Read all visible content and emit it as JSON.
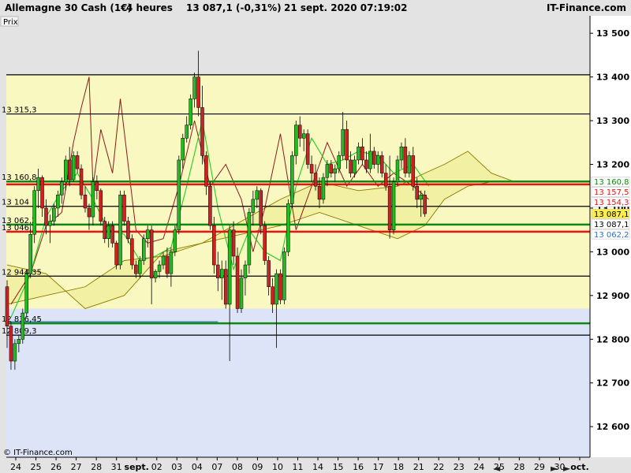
{
  "header": {
    "instrument": "Allemagne 30 Cash (1€)",
    "timeframe": "4 heures",
    "quote": "13 087,1 (-0,31%)",
    "datetime": "21 sept. 2020 07:19:02",
    "site": "IT-Finance.com"
  },
  "panel_label": "Prix",
  "copyright": "© IT-Finance.com",
  "nav_arrows": [
    "◄",
    "►",
    "►"
  ],
  "colors": {
    "bull": "#22bb22",
    "bear": "#cc2222",
    "resistance": "#ee1111",
    "support": "#118811",
    "zone_upper": "#f8f8c0",
    "zone_lower": "#dde4f8",
    "cloud": "#f0ed9a",
    "kijun": "#8b1a1a",
    "tenkan": "#22cc22",
    "chikou": "#3070cc",
    "senkou": "#8a7a00"
  },
  "chart_data": {
    "type": "candlestick",
    "yaxis": {
      "ticks": [
        "13 500",
        "13 400",
        "13 300",
        "13 200",
        "13 100",
        "13 000",
        "12 900",
        "12 800",
        "12 700",
        "12 600"
      ],
      "tick_values": [
        13500,
        13400,
        13300,
        13200,
        13100,
        13000,
        12900,
        12800,
        12700,
        12600
      ],
      "ylim": [
        12530,
        13540
      ]
    },
    "xaxis": {
      "ticks": [
        "24",
        "25",
        "26",
        "27",
        "28",
        "31",
        "sept.",
        "02",
        "03",
        "04",
        "07",
        "08",
        "09",
        "10",
        "11",
        "14",
        "15",
        "16",
        "17",
        "18",
        "21",
        "22",
        "23",
        "24",
        "25",
        "28",
        "29",
        "30",
        "oct."
      ]
    },
    "zones": [
      {
        "from": 12870,
        "to": 13405,
        "color": "upper"
      },
      {
        "from": 12530,
        "to": 12870,
        "color": "lower"
      }
    ],
    "levels": [
      {
        "value": 13405,
        "label": "",
        "kind": "black"
      },
      {
        "value": 13315.3,
        "label": "13 315,3",
        "kind": "black"
      },
      {
        "value": 13160.8,
        "label": "13 160,8",
        "kind": "support"
      },
      {
        "value": 13154.3,
        "label": "",
        "kind": "resistance"
      },
      {
        "value": 13104,
        "label": "13 104",
        "kind": "black"
      },
      {
        "value": 13062.2,
        "label": "13 062,2",
        "kind": "support"
      },
      {
        "value": 13046.1,
        "label": "13 046,1",
        "kind": "resistance"
      },
      {
        "value": 12944.35,
        "label": "12 944,35",
        "kind": "black"
      },
      {
        "value": 12836.45,
        "label": "12 836,45",
        "kind": "support"
      },
      {
        "value": 12809.3,
        "label": "12 809,3",
        "kind": "black"
      }
    ],
    "price_badges": [
      {
        "value": 13160.8,
        "label": "13 160,8",
        "color": "#118811",
        "bg": "#ffffff"
      },
      {
        "value": 13157.5,
        "label": "13 157,5",
        "color": "#ee1111",
        "bg": "#ffffff"
      },
      {
        "value": 13154.3,
        "label": "13 154,3",
        "color": "#ee1111",
        "bg": "#ffffff"
      },
      {
        "value": 13087.1,
        "label": "13 087,1",
        "color": "#000000",
        "bg": "#ffee44"
      },
      {
        "value": 13087.1,
        "label": "13 087,1",
        "color": "#000000",
        "bg": "#ffffff"
      },
      {
        "value": 13062.2,
        "label": "13 062,2",
        "color": "#3070cc",
        "bg": "#ffffff"
      }
    ],
    "candles": [
      [
        12920,
        12935,
        12780,
        12830
      ],
      [
        12830,
        12840,
        12730,
        12750
      ],
      [
        12750,
        12800,
        12730,
        12790
      ],
      [
        12790,
        12810,
        12770,
        12800
      ],
      [
        12800,
        12870,
        12790,
        12860
      ],
      [
        12860,
        12960,
        12850,
        12950
      ],
      [
        12950,
        13060,
        12940,
        13040
      ],
      [
        13040,
        13150,
        13020,
        13140
      ],
      [
        13140,
        13190,
        13100,
        13170
      ],
      [
        13170,
        13175,
        13080,
        13100
      ],
      [
        13100,
        13120,
        13040,
        13060
      ],
      [
        13060,
        13085,
        13020,
        13070
      ],
      [
        13070,
        13110,
        13060,
        13100
      ],
      [
        13100,
        13140,
        13080,
        13130
      ],
      [
        13130,
        13170,
        13110,
        13160
      ],
      [
        13160,
        13220,
        13140,
        13210
      ],
      [
        13210,
        13240,
        13150,
        13165
      ],
      [
        13165,
        13230,
        13160,
        13220
      ],
      [
        13220,
        13230,
        13180,
        13190
      ],
      [
        13190,
        13200,
        13120,
        13130
      ],
      [
        13130,
        13150,
        13090,
        13100
      ],
      [
        13100,
        13110,
        13050,
        13080
      ],
      [
        13080,
        13170,
        13060,
        13160
      ],
      [
        13160,
        13175,
        13120,
        13140
      ],
      [
        13140,
        13145,
        13060,
        13070
      ],
      [
        13070,
        13080,
        13020,
        13030
      ],
      [
        13030,
        13070,
        13010,
        13060
      ],
      [
        13060,
        13070,
        13010,
        13020
      ],
      [
        13020,
        13025,
        12960,
        12970
      ],
      [
        12970,
        13140,
        12960,
        13130
      ],
      [
        13130,
        13140,
        13060,
        13070
      ],
      [
        13070,
        13080,
        13020,
        13030
      ],
      [
        13030,
        13040,
        12960,
        12970
      ],
      [
        12970,
        12980,
        12940,
        12950
      ],
      [
        12950,
        12990,
        12940,
        12980
      ],
      [
        12980,
        13040,
        12970,
        13030
      ],
      [
        13030,
        13060,
        13010,
        13050
      ],
      [
        13050,
        13060,
        12880,
        12940
      ],
      [
        12940,
        12960,
        12930,
        12955
      ],
      [
        12955,
        12980,
        12940,
        12970
      ],
      [
        12970,
        13000,
        12960,
        12990
      ],
      [
        12990,
        13010,
        12940,
        12950
      ],
      [
        12950,
        13010,
        12920,
        13000
      ],
      [
        13000,
        13060,
        12990,
        13050
      ],
      [
        13050,
        13220,
        13040,
        13210
      ],
      [
        13210,
        13270,
        13190,
        13260
      ],
      [
        13260,
        13310,
        13250,
        13290
      ],
      [
        13290,
        13360,
        13280,
        13350
      ],
      [
        13350,
        13410,
        13330,
        13400
      ],
      [
        13400,
        13460,
        13310,
        13330
      ],
      [
        13330,
        13380,
        13200,
        13220
      ],
      [
        13220,
        13230,
        13130,
        13150
      ],
      [
        13150,
        13160,
        13050,
        13060
      ],
      [
        13060,
        13080,
        12950,
        12970
      ],
      [
        12970,
        13000,
        12910,
        12940
      ],
      [
        12940,
        12980,
        12890,
        12960
      ],
      [
        12960,
        12980,
        12870,
        12880
      ],
      [
        12880,
        13060,
        12750,
        13050
      ],
      [
        13050,
        13070,
        12970,
        12990
      ],
      [
        12990,
        13010,
        12860,
        12870
      ],
      [
        12870,
        12960,
        12860,
        12940
      ],
      [
        12940,
        12980,
        12900,
        12970
      ],
      [
        12970,
        13100,
        12950,
        13090
      ],
      [
        13090,
        13140,
        13060,
        13120
      ],
      [
        13120,
        13150,
        13100,
        13140
      ],
      [
        13140,
        13145,
        13040,
        13060
      ],
      [
        13060,
        13070,
        12970,
        12980
      ],
      [
        12980,
        12990,
        12900,
        12920
      ],
      [
        12920,
        12940,
        12860,
        12880
      ],
      [
        12880,
        12960,
        12780,
        12950
      ],
      [
        12950,
        12960,
        12880,
        12890
      ],
      [
        12890,
        13010,
        12880,
        13000
      ],
      [
        13000,
        13120,
        12990,
        13110
      ],
      [
        13110,
        13230,
        13100,
        13220
      ],
      [
        13220,
        13300,
        13200,
        13290
      ],
      [
        13290,
        13310,
        13240,
        13260
      ],
      [
        13260,
        13280,
        13230,
        13270
      ],
      [
        13270,
        13280,
        13190,
        13200
      ],
      [
        13200,
        13220,
        13160,
        13180
      ],
      [
        13180,
        13200,
        13140,
        13150
      ],
      [
        13150,
        13170,
        13100,
        13120
      ],
      [
        13120,
        13180,
        13110,
        13170
      ],
      [
        13170,
        13210,
        13150,
        13200
      ],
      [
        13200,
        13210,
        13170,
        13180
      ],
      [
        13180,
        13200,
        13160,
        13190
      ],
      [
        13190,
        13230,
        13180,
        13220
      ],
      [
        13220,
        13320,
        13210,
        13280
      ],
      [
        13280,
        13300,
        13190,
        13210
      ],
      [
        13210,
        13230,
        13170,
        13180
      ],
      [
        13180,
        13220,
        13170,
        13210
      ],
      [
        13210,
        13250,
        13200,
        13240
      ],
      [
        13240,
        13260,
        13200,
        13210
      ],
      [
        13210,
        13230,
        13180,
        13190
      ],
      [
        13190,
        13270,
        13180,
        13230
      ],
      [
        13230,
        13240,
        13190,
        13200
      ],
      [
        13200,
        13230,
        13180,
        13220
      ],
      [
        13220,
        13230,
        13170,
        13180
      ],
      [
        13180,
        13200,
        13140,
        13150
      ],
      [
        13150,
        13220,
        13030,
        13050
      ],
      [
        13050,
        13170,
        13040,
        13160
      ],
      [
        13160,
        13220,
        13150,
        13210
      ],
      [
        13210,
        13250,
        13190,
        13240
      ],
      [
        13240,
        13260,
        13170,
        13180
      ],
      [
        13180,
        13230,
        13170,
        13220
      ],
      [
        13220,
        13240,
        13140,
        13150
      ],
      [
        13150,
        13170,
        13100,
        13120
      ],
      [
        13120,
        13140,
        13080,
        13130
      ],
      [
        13130,
        13140,
        13080,
        13087.1
      ]
    ],
    "series": {
      "kijun": [
        [
          1,
          12880
        ],
        [
          6,
          12950
        ],
        [
          10,
          13060
        ],
        [
          14,
          13090
        ],
        [
          17,
          13250
        ],
        [
          19,
          13330
        ],
        [
          21,
          13400
        ],
        [
          22,
          13150
        ],
        [
          24,
          13280
        ],
        [
          27,
          13180
        ],
        [
          29,
          13350
        ],
        [
          33,
          13050
        ],
        [
          36,
          13020
        ],
        [
          40,
          13030
        ],
        [
          44,
          13150
        ],
        [
          48,
          13300
        ],
        [
          52,
          13150
        ],
        [
          56,
          13200
        ],
        [
          60,
          13120
        ],
        [
          63,
          13000
        ],
        [
          66,
          13100
        ],
        [
          70,
          13270
        ],
        [
          74,
          13050
        ],
        [
          78,
          13150
        ],
        [
          82,
          13250
        ],
        [
          87,
          13150
        ],
        [
          91,
          13200
        ],
        [
          95,
          13150
        ],
        [
          99,
          13180
        ],
        [
          104,
          13150
        ],
        [
          108,
          13120
        ]
      ],
      "tenkan": [
        [
          1,
          12850
        ],
        [
          6,
          12950
        ],
        [
          10,
          13080
        ],
        [
          14,
          13140
        ],
        [
          18,
          13180
        ],
        [
          22,
          13120
        ],
        [
          26,
          13050
        ],
        [
          30,
          13040
        ],
        [
          34,
          12980
        ],
        [
          38,
          12990
        ],
        [
          42,
          13010
        ],
        [
          46,
          13150
        ],
        [
          50,
          13300
        ],
        [
          54,
          13100
        ],
        [
          58,
          12960
        ],
        [
          62,
          13050
        ],
        [
          66,
          13000
        ],
        [
          70,
          12980
        ],
        [
          74,
          13150
        ],
        [
          78,
          13260
        ],
        [
          82,
          13200
        ],
        [
          86,
          13210
        ],
        [
          90,
          13230
        ],
        [
          95,
          13220
        ],
        [
          99,
          13180
        ],
        [
          104,
          13200
        ],
        [
          108,
          13150
        ]
      ],
      "chikou": [
        [
          0,
          12840
        ],
        [
          20,
          12840
        ],
        [
          40,
          12840
        ],
        [
          54,
          12840
        ]
      ],
      "senkou_a": [
        [
          0,
          12970
        ],
        [
          10,
          12950
        ],
        [
          20,
          12870
        ],
        [
          30,
          12900
        ],
        [
          40,
          13000
        ],
        [
          50,
          13020
        ],
        [
          60,
          13070
        ],
        [
          70,
          13120
        ],
        [
          80,
          13160
        ],
        [
          90,
          13140
        ],
        [
          100,
          13150
        ],
        [
          107,
          13180
        ],
        [
          112,
          13200
        ],
        [
          118,
          13230
        ],
        [
          124,
          13180
        ],
        [
          130,
          13160
        ]
      ],
      "senkou_b": [
        [
          0,
          12880
        ],
        [
          10,
          12900
        ],
        [
          20,
          12920
        ],
        [
          30,
          12980
        ],
        [
          40,
          12990
        ],
        [
          50,
          13020
        ],
        [
          60,
          13040
        ],
        [
          70,
          13060
        ],
        [
          80,
          13090
        ],
        [
          90,
          13060
        ],
        [
          100,
          13030
        ],
        [
          107,
          13060
        ],
        [
          112,
          13120
        ],
        [
          118,
          13150
        ],
        [
          124,
          13160
        ],
        [
          130,
          13160
        ]
      ]
    }
  }
}
